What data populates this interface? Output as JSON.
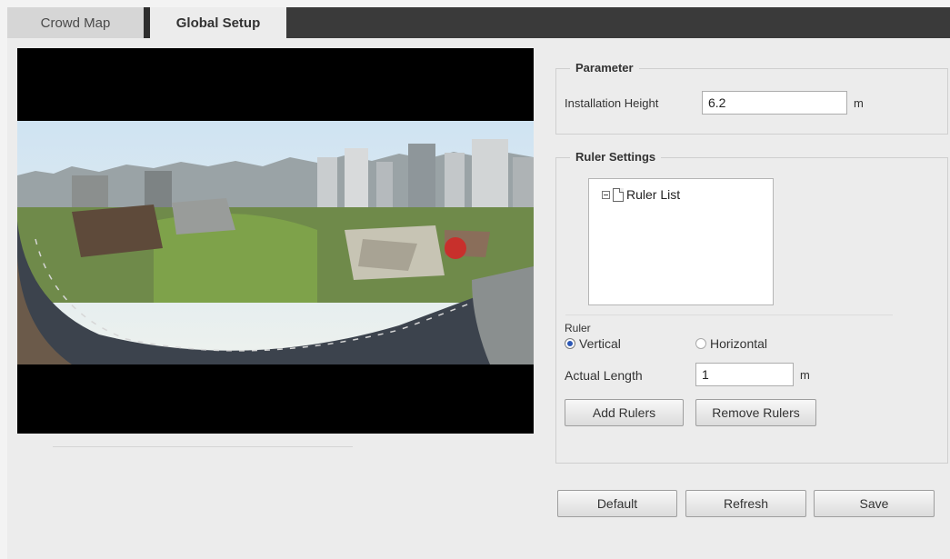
{
  "tabs": [
    {
      "label": "Crowd Map",
      "active": false
    },
    {
      "label": "Global Setup",
      "active": true
    }
  ],
  "parameter": {
    "legend": "Parameter",
    "installation_height_label": "Installation Height",
    "installation_height_value": "6.2",
    "unit": "m"
  },
  "ruler_settings": {
    "legend": "Ruler Settings",
    "tree_root": "Ruler List",
    "ruler_label": "Ruler",
    "vertical_label": "Vertical",
    "horizontal_label": "Horizontal",
    "selected_orientation": "Vertical",
    "actual_length_label": "Actual Length",
    "actual_length_value": "1",
    "unit": "m",
    "add_button": "Add Rulers",
    "remove_button": "Remove Rulers"
  },
  "footer_buttons": {
    "default": "Default",
    "refresh": "Refresh",
    "save": "Save"
  },
  "colors": {
    "tab_bar": "#3a3a3a",
    "panel_bg": "#ececec",
    "video_bg": "#000000",
    "radio_selected": "#2b57b5"
  }
}
